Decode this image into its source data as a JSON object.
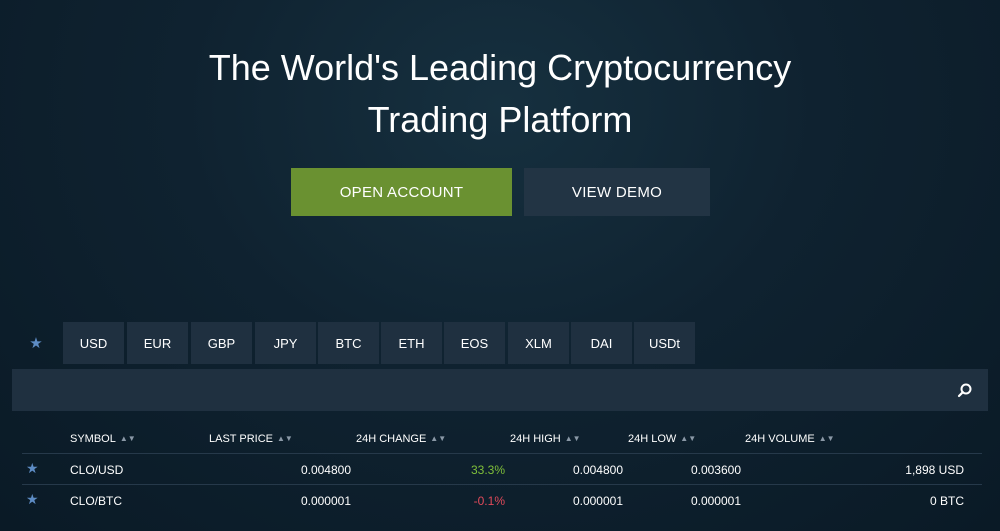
{
  "hero": {
    "title_line1": "The World's Leading Cryptocurrency",
    "title_line2": "Trading Platform",
    "open_account_label": "OPEN ACCOUNT",
    "view_demo_label": "VIEW DEMO"
  },
  "tabs": [
    "USD",
    "EUR",
    "GBP",
    "JPY",
    "BTC",
    "ETH",
    "EOS",
    "XLM",
    "DAI",
    "USDt"
  ],
  "search": {
    "placeholder": ""
  },
  "table": {
    "columns": [
      "SYMBOL",
      "LAST PRICE",
      "24H CHANGE",
      "24H HIGH",
      "24H LOW",
      "24H VOLUME"
    ],
    "rows": [
      {
        "symbol": "CLO/USD",
        "last_price": "0.004800",
        "change": "33.3%",
        "high": "0.004800",
        "low": "0.003600",
        "volume": "1,898 USD"
      },
      {
        "symbol": "CLO/BTC",
        "last_price": "0.000001",
        "change": "-0.1%",
        "high": "0.000001",
        "low": "0.000001",
        "volume": "0 BTC"
      }
    ]
  },
  "colors": {
    "accent_green": "#6a9131",
    "positive": "#7fbf3a",
    "negative": "#e04a5a",
    "star": "#5d8cc4"
  },
  "icons": {
    "favorite": "star-icon",
    "search": "search-icon",
    "sort": "sort-icon"
  }
}
